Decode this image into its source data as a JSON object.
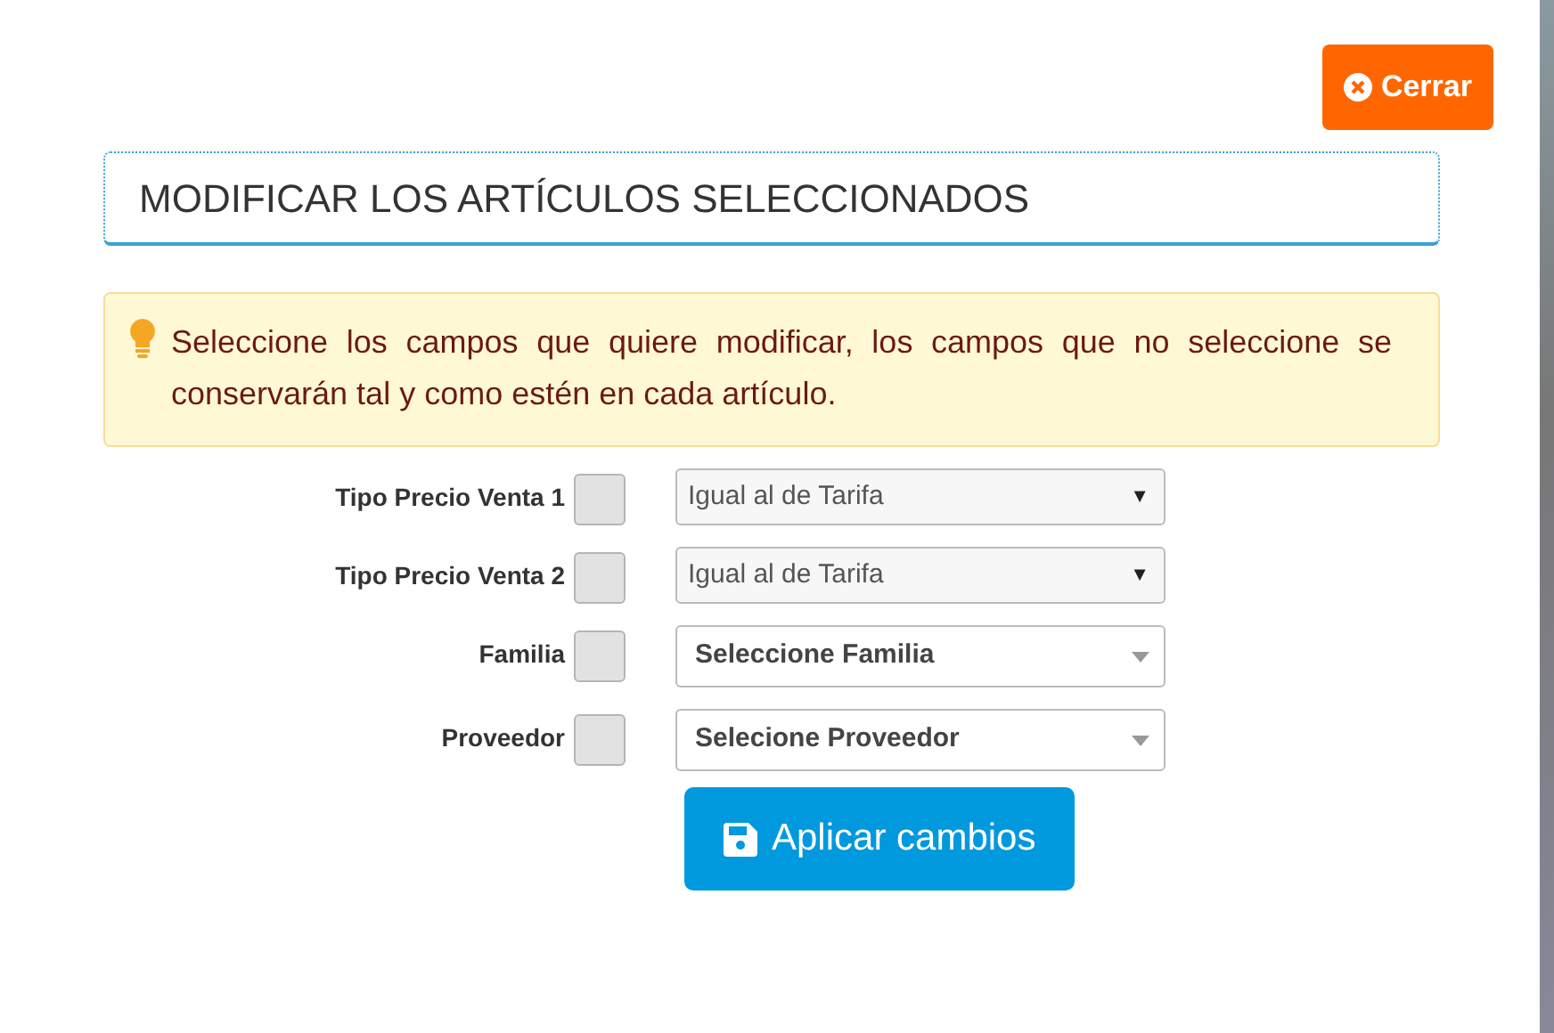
{
  "close_button": {
    "label": "Cerrar"
  },
  "title": "MODIFICAR LOS ARTÍCULOS SELECCIONADOS",
  "notice": "Seleccione los campos que quiere modificar, los campos que no seleccione se conservarán tal y como estén en cada artículo.",
  "fields": [
    {
      "label": "Tipo Precio Venta 1",
      "checked": false,
      "kind": "native",
      "value": "Igual al de Tarifa",
      "caret": "▼"
    },
    {
      "label": "Tipo Precio Venta 2",
      "checked": false,
      "kind": "native",
      "value": "Igual al de Tarifa",
      "caret": "▼"
    },
    {
      "label": "Familia",
      "checked": false,
      "kind": "searchable",
      "value": "Seleccione Familia"
    },
    {
      "label": "Proveedor",
      "checked": false,
      "kind": "searchable",
      "value": "Selecione Proveedor"
    }
  ],
  "apply_button": {
    "label": "Aplicar cambios"
  }
}
